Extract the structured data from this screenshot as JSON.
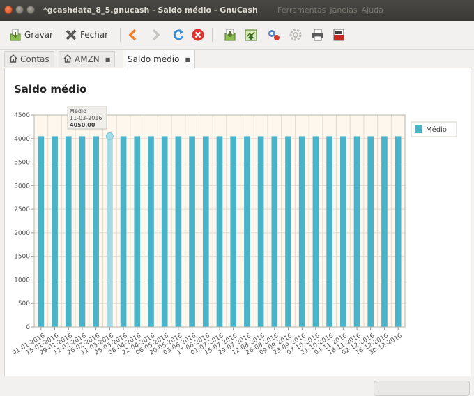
{
  "window": {
    "title": "*gcashdata_8_5.gnucash - Saldo médio - GnuCash",
    "menu_items": [
      "Ferramentas",
      "Janelas",
      "Ajuda"
    ]
  },
  "toolbar": {
    "save_label": "Gravar",
    "close_label": "Fechar"
  },
  "tabs": [
    {
      "label": "Contas",
      "icon": "home-icon"
    },
    {
      "label": "AMZN",
      "icon": "home-icon"
    },
    {
      "label": "Saldo médio",
      "icon": ""
    }
  ],
  "report": {
    "title": "Saldo médio"
  },
  "tooltip": {
    "series": "Médio",
    "date": "11-03-2016",
    "value": "4050.00"
  },
  "colors": {
    "bar": "#4ab3c8",
    "bar_highlight": "#a5dbe7",
    "plot_background": "#fdf7ee"
  },
  "chart_data": {
    "type": "bar",
    "title": "",
    "xlabel": "",
    "ylabel": "",
    "ylim": [
      0,
      4500
    ],
    "yticks": [
      0,
      500,
      1000,
      1500,
      2000,
      2500,
      3000,
      3500,
      4000,
      4500
    ],
    "grid": true,
    "legend_position": "right",
    "highlighted_index": 5,
    "categories": [
      "01-01-2016",
      "15-01-2016",
      "29-01-2016",
      "12-02-2016",
      "26-02-2016",
      "11-03-2016",
      "25-03-2016",
      "08-04-2016",
      "22-04-2016",
      "06-05-2016",
      "20-05-2016",
      "03-06-2016",
      "17-06-2016",
      "01-07-2016",
      "15-07-2016",
      "29-07-2016",
      "12-08-2016",
      "26-08-2016",
      "09-09-2016",
      "23-09-2016",
      "07-10-2016",
      "21-10-2016",
      "04-11-2016",
      "18-11-2016",
      "02-12-2016",
      "16-12-2016",
      "30-12-2016"
    ],
    "series": [
      {
        "name": "Médio",
        "values": [
          4050,
          4050,
          4050,
          4050,
          4050,
          4050,
          4050,
          4050,
          4050,
          4050,
          4050,
          4050,
          4050,
          4050,
          4050,
          4050,
          4050,
          4050,
          4050,
          4050,
          4050,
          4050,
          4050,
          4050,
          4050,
          4050,
          4050
        ]
      }
    ]
  }
}
